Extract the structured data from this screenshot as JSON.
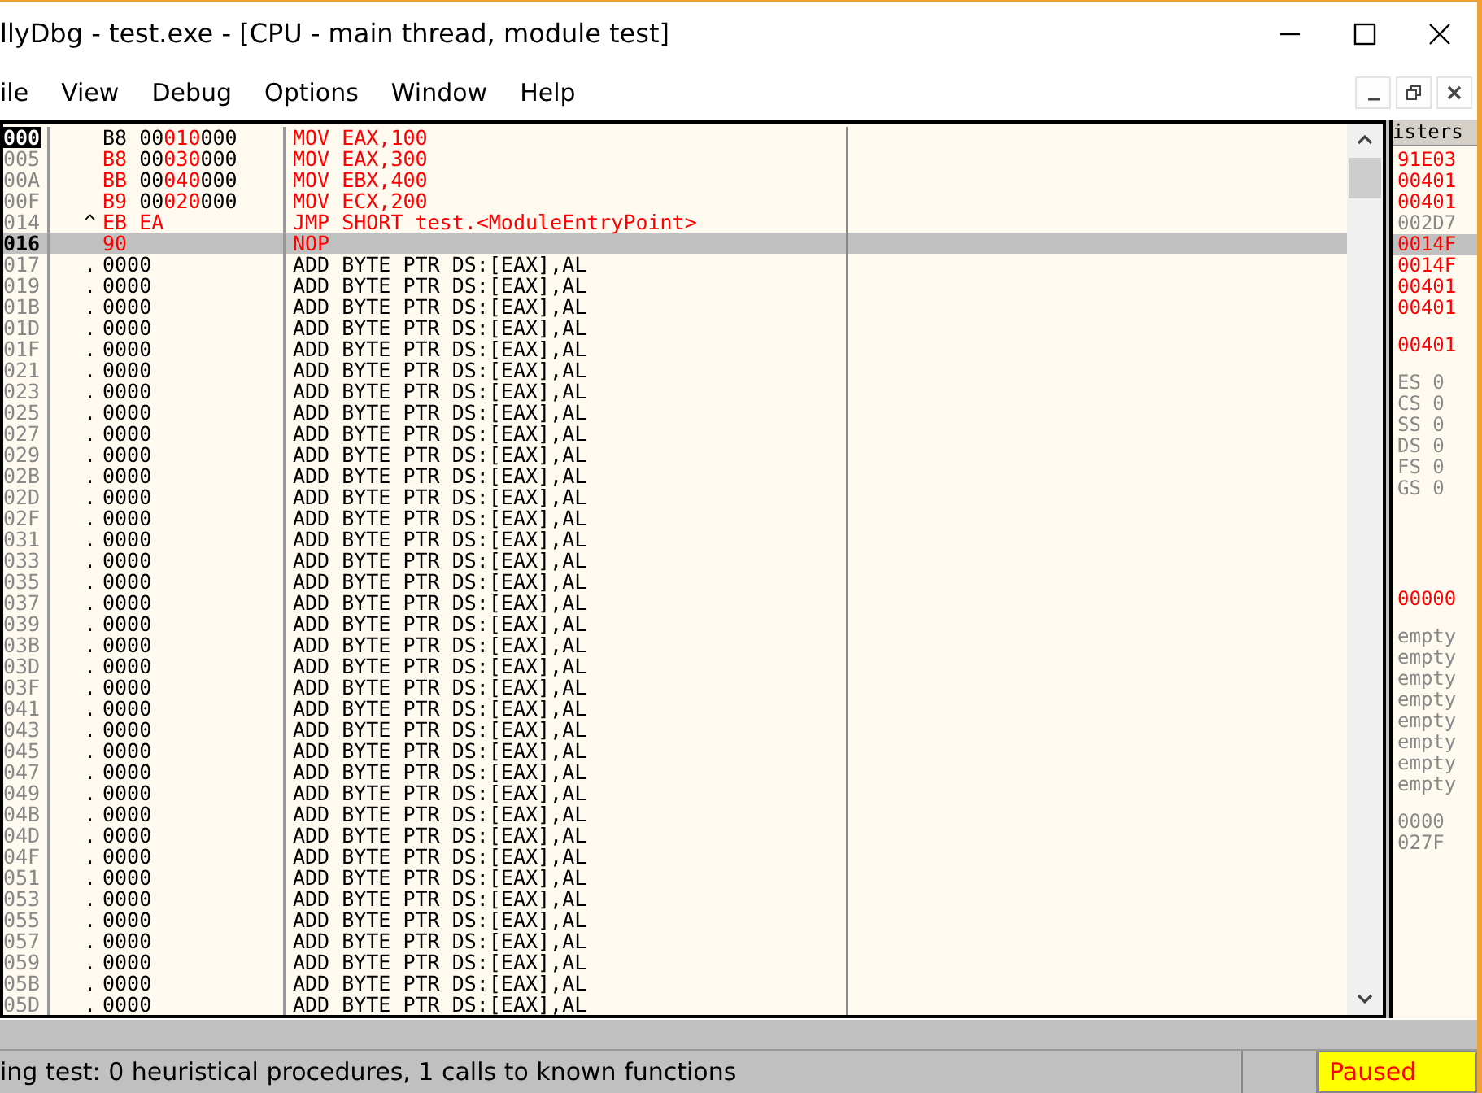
{
  "window": {
    "title": "llyDbg - test.exe - [CPU - main thread, module test]"
  },
  "menu": [
    "ile",
    "View",
    "Debug",
    "Options",
    "Window",
    "Help"
  ],
  "disassembly": {
    "rows": [
      {
        "address": "000",
        "marker": "",
        "hex": [
          {
            "text": "B8 00",
            "changed": false
          },
          {
            "text": "010",
            "changed": true
          },
          {
            "text": "000",
            "changed": false
          }
        ],
        "disasm": "MOV EAX,100",
        "modified": true,
        "selected": true,
        "current": false
      },
      {
        "address": "005",
        "marker": "",
        "hex": [
          {
            "text": "B8",
            "changed": true
          },
          {
            "text": " 00",
            "changed": false
          },
          {
            "text": "030",
            "changed": true
          },
          {
            "text": "000",
            "changed": false
          }
        ],
        "disasm": "MOV EAX,300",
        "modified": true,
        "selected": false,
        "current": false
      },
      {
        "address": "00A",
        "marker": "",
        "hex": [
          {
            "text": "BB",
            "changed": true
          },
          {
            "text": " 00",
            "changed": false
          },
          {
            "text": "040",
            "changed": true
          },
          {
            "text": "000",
            "changed": false
          }
        ],
        "disasm": "MOV EBX,400",
        "modified": true,
        "selected": false,
        "current": false
      },
      {
        "address": "00F",
        "marker": "",
        "hex": [
          {
            "text": "B9",
            "changed": true
          },
          {
            "text": " 00",
            "changed": false
          },
          {
            "text": "020",
            "changed": true
          },
          {
            "text": "000",
            "changed": false
          }
        ],
        "disasm": "MOV ECX,200",
        "modified": true,
        "selected": false,
        "current": false
      },
      {
        "address": "014",
        "marker": "^",
        "hex": [
          {
            "text": "EB EA",
            "changed": true
          }
        ],
        "disasm": "JMP SHORT test.<ModuleEntryPoint>",
        "modified": true,
        "selected": false,
        "current": false
      },
      {
        "address": "016",
        "marker": "",
        "hex": [
          {
            "text": "90",
            "changed": true
          }
        ],
        "disasm": "NOP",
        "modified": true,
        "selected": false,
        "current": true
      },
      {
        "address": "017",
        "marker": ".",
        "hex": [
          {
            "text": "0000",
            "changed": false
          }
        ],
        "disasm": "ADD BYTE PTR DS:[EAX],AL",
        "modified": false,
        "selected": false,
        "current": false
      },
      {
        "address": "019",
        "marker": ".",
        "hex": [
          {
            "text": "0000",
            "changed": false
          }
        ],
        "disasm": "ADD BYTE PTR DS:[EAX],AL",
        "modified": false,
        "selected": false,
        "current": false
      },
      {
        "address": "01B",
        "marker": ".",
        "hex": [
          {
            "text": "0000",
            "changed": false
          }
        ],
        "disasm": "ADD BYTE PTR DS:[EAX],AL",
        "modified": false,
        "selected": false,
        "current": false
      },
      {
        "address": "01D",
        "marker": ".",
        "hex": [
          {
            "text": "0000",
            "changed": false
          }
        ],
        "disasm": "ADD BYTE PTR DS:[EAX],AL",
        "modified": false,
        "selected": false,
        "current": false
      },
      {
        "address": "01F",
        "marker": ".",
        "hex": [
          {
            "text": "0000",
            "changed": false
          }
        ],
        "disasm": "ADD BYTE PTR DS:[EAX],AL",
        "modified": false,
        "selected": false,
        "current": false
      },
      {
        "address": "021",
        "marker": ".",
        "hex": [
          {
            "text": "0000",
            "changed": false
          }
        ],
        "disasm": "ADD BYTE PTR DS:[EAX],AL",
        "modified": false,
        "selected": false,
        "current": false
      },
      {
        "address": "023",
        "marker": ".",
        "hex": [
          {
            "text": "0000",
            "changed": false
          }
        ],
        "disasm": "ADD BYTE PTR DS:[EAX],AL",
        "modified": false,
        "selected": false,
        "current": false
      },
      {
        "address": "025",
        "marker": ".",
        "hex": [
          {
            "text": "0000",
            "changed": false
          }
        ],
        "disasm": "ADD BYTE PTR DS:[EAX],AL",
        "modified": false,
        "selected": false,
        "current": false
      },
      {
        "address": "027",
        "marker": ".",
        "hex": [
          {
            "text": "0000",
            "changed": false
          }
        ],
        "disasm": "ADD BYTE PTR DS:[EAX],AL",
        "modified": false,
        "selected": false,
        "current": false
      },
      {
        "address": "029",
        "marker": ".",
        "hex": [
          {
            "text": "0000",
            "changed": false
          }
        ],
        "disasm": "ADD BYTE PTR DS:[EAX],AL",
        "modified": false,
        "selected": false,
        "current": false
      },
      {
        "address": "02B",
        "marker": ".",
        "hex": [
          {
            "text": "0000",
            "changed": false
          }
        ],
        "disasm": "ADD BYTE PTR DS:[EAX],AL",
        "modified": false,
        "selected": false,
        "current": false
      },
      {
        "address": "02D",
        "marker": ".",
        "hex": [
          {
            "text": "0000",
            "changed": false
          }
        ],
        "disasm": "ADD BYTE PTR DS:[EAX],AL",
        "modified": false,
        "selected": false,
        "current": false
      },
      {
        "address": "02F",
        "marker": ".",
        "hex": [
          {
            "text": "0000",
            "changed": false
          }
        ],
        "disasm": "ADD BYTE PTR DS:[EAX],AL",
        "modified": false,
        "selected": false,
        "current": false
      },
      {
        "address": "031",
        "marker": ".",
        "hex": [
          {
            "text": "0000",
            "changed": false
          }
        ],
        "disasm": "ADD BYTE PTR DS:[EAX],AL",
        "modified": false,
        "selected": false,
        "current": false
      },
      {
        "address": "033",
        "marker": ".",
        "hex": [
          {
            "text": "0000",
            "changed": false
          }
        ],
        "disasm": "ADD BYTE PTR DS:[EAX],AL",
        "modified": false,
        "selected": false,
        "current": false
      },
      {
        "address": "035",
        "marker": ".",
        "hex": [
          {
            "text": "0000",
            "changed": false
          }
        ],
        "disasm": "ADD BYTE PTR DS:[EAX],AL",
        "modified": false,
        "selected": false,
        "current": false
      },
      {
        "address": "037",
        "marker": ".",
        "hex": [
          {
            "text": "0000",
            "changed": false
          }
        ],
        "disasm": "ADD BYTE PTR DS:[EAX],AL",
        "modified": false,
        "selected": false,
        "current": false
      },
      {
        "address": "039",
        "marker": ".",
        "hex": [
          {
            "text": "0000",
            "changed": false
          }
        ],
        "disasm": "ADD BYTE PTR DS:[EAX],AL",
        "modified": false,
        "selected": false,
        "current": false
      },
      {
        "address": "03B",
        "marker": ".",
        "hex": [
          {
            "text": "0000",
            "changed": false
          }
        ],
        "disasm": "ADD BYTE PTR DS:[EAX],AL",
        "modified": false,
        "selected": false,
        "current": false
      },
      {
        "address": "03D",
        "marker": ".",
        "hex": [
          {
            "text": "0000",
            "changed": false
          }
        ],
        "disasm": "ADD BYTE PTR DS:[EAX],AL",
        "modified": false,
        "selected": false,
        "current": false
      },
      {
        "address": "03F",
        "marker": ".",
        "hex": [
          {
            "text": "0000",
            "changed": false
          }
        ],
        "disasm": "ADD BYTE PTR DS:[EAX],AL",
        "modified": false,
        "selected": false,
        "current": false
      },
      {
        "address": "041",
        "marker": ".",
        "hex": [
          {
            "text": "0000",
            "changed": false
          }
        ],
        "disasm": "ADD BYTE PTR DS:[EAX],AL",
        "modified": false,
        "selected": false,
        "current": false
      },
      {
        "address": "043",
        "marker": ".",
        "hex": [
          {
            "text": "0000",
            "changed": false
          }
        ],
        "disasm": "ADD BYTE PTR DS:[EAX],AL",
        "modified": false,
        "selected": false,
        "current": false
      },
      {
        "address": "045",
        "marker": ".",
        "hex": [
          {
            "text": "0000",
            "changed": false
          }
        ],
        "disasm": "ADD BYTE PTR DS:[EAX],AL",
        "modified": false,
        "selected": false,
        "current": false
      },
      {
        "address": "047",
        "marker": ".",
        "hex": [
          {
            "text": "0000",
            "changed": false
          }
        ],
        "disasm": "ADD BYTE PTR DS:[EAX],AL",
        "modified": false,
        "selected": false,
        "current": false
      },
      {
        "address": "049",
        "marker": ".",
        "hex": [
          {
            "text": "0000",
            "changed": false
          }
        ],
        "disasm": "ADD BYTE PTR DS:[EAX],AL",
        "modified": false,
        "selected": false,
        "current": false
      },
      {
        "address": "04B",
        "marker": ".",
        "hex": [
          {
            "text": "0000",
            "changed": false
          }
        ],
        "disasm": "ADD BYTE PTR DS:[EAX],AL",
        "modified": false,
        "selected": false,
        "current": false
      },
      {
        "address": "04D",
        "marker": ".",
        "hex": [
          {
            "text": "0000",
            "changed": false
          }
        ],
        "disasm": "ADD BYTE PTR DS:[EAX],AL",
        "modified": false,
        "selected": false,
        "current": false
      },
      {
        "address": "04F",
        "marker": ".",
        "hex": [
          {
            "text": "0000",
            "changed": false
          }
        ],
        "disasm": "ADD BYTE PTR DS:[EAX],AL",
        "modified": false,
        "selected": false,
        "current": false
      },
      {
        "address": "051",
        "marker": ".",
        "hex": [
          {
            "text": "0000",
            "changed": false
          }
        ],
        "disasm": "ADD BYTE PTR DS:[EAX],AL",
        "modified": false,
        "selected": false,
        "current": false
      },
      {
        "address": "053",
        "marker": ".",
        "hex": [
          {
            "text": "0000",
            "changed": false
          }
        ],
        "disasm": "ADD BYTE PTR DS:[EAX],AL",
        "modified": false,
        "selected": false,
        "current": false
      },
      {
        "address": "055",
        "marker": ".",
        "hex": [
          {
            "text": "0000",
            "changed": false
          }
        ],
        "disasm": "ADD BYTE PTR DS:[EAX],AL",
        "modified": false,
        "selected": false,
        "current": false
      },
      {
        "address": "057",
        "marker": ".",
        "hex": [
          {
            "text": "0000",
            "changed": false
          }
        ],
        "disasm": "ADD BYTE PTR DS:[EAX],AL",
        "modified": false,
        "selected": false,
        "current": false
      },
      {
        "address": "059",
        "marker": ".",
        "hex": [
          {
            "text": "0000",
            "changed": false
          }
        ],
        "disasm": "ADD BYTE PTR DS:[EAX],AL",
        "modified": false,
        "selected": false,
        "current": false
      },
      {
        "address": "05B",
        "marker": ".",
        "hex": [
          {
            "text": "0000",
            "changed": false
          }
        ],
        "disasm": "ADD BYTE PTR DS:[EAX],AL",
        "modified": false,
        "selected": false,
        "current": false
      },
      {
        "address": "05D",
        "marker": ".",
        "hex": [
          {
            "text": "0000",
            "changed": false
          }
        ],
        "disasm": "ADD BYTE PTR DS:[EAX],AL",
        "modified": false,
        "selected": false,
        "current": false
      }
    ]
  },
  "registers": {
    "header": "isters",
    "groups": [
      [
        {
          "text": "91E03",
          "changed": true,
          "selected": false
        },
        {
          "text": "00401",
          "changed": true,
          "selected": false
        },
        {
          "text": "00401",
          "changed": true,
          "selected": false
        },
        {
          "text": "002D7",
          "changed": false,
          "selected": false
        },
        {
          "text": "0014F",
          "changed": true,
          "selected": true
        },
        {
          "text": "0014F",
          "changed": true,
          "selected": false
        },
        {
          "text": "00401",
          "changed": true,
          "selected": false
        },
        {
          "text": "00401",
          "changed": true,
          "selected": false
        }
      ],
      [
        {
          "text": "00401",
          "changed": true,
          "selected": false
        }
      ],
      [
        {
          "text": "ES 0",
          "changed": false,
          "selected": false
        },
        {
          "text": "CS 0",
          "changed": false,
          "selected": false
        },
        {
          "text": "SS 0",
          "changed": false,
          "selected": false
        },
        {
          "text": "DS 0",
          "changed": false,
          "selected": false
        },
        {
          "text": "FS 0",
          "changed": false,
          "selected": false
        },
        {
          "text": "GS 0",
          "changed": false,
          "selected": false
        }
      ],
      [
        {
          "text": "00000",
          "changed": true,
          "selected": false
        }
      ],
      [
        {
          "text": "empty",
          "changed": false,
          "selected": false
        },
        {
          "text": "empty",
          "changed": false,
          "selected": false
        },
        {
          "text": "empty",
          "changed": false,
          "selected": false
        },
        {
          "text": "empty",
          "changed": false,
          "selected": false
        },
        {
          "text": "empty",
          "changed": false,
          "selected": false
        },
        {
          "text": "empty",
          "changed": false,
          "selected": false
        },
        {
          "text": "empty",
          "changed": false,
          "selected": false
        },
        {
          "text": "empty",
          "changed": false,
          "selected": false
        }
      ],
      [
        {
          "text": "0000",
          "changed": false,
          "selected": false
        },
        {
          "text": "027F",
          "changed": false,
          "selected": false
        }
      ]
    ]
  },
  "status_bar": {
    "message": "ing test: 0 heuristical procedures, 1 calls to known functions",
    "state": "Paused"
  }
}
